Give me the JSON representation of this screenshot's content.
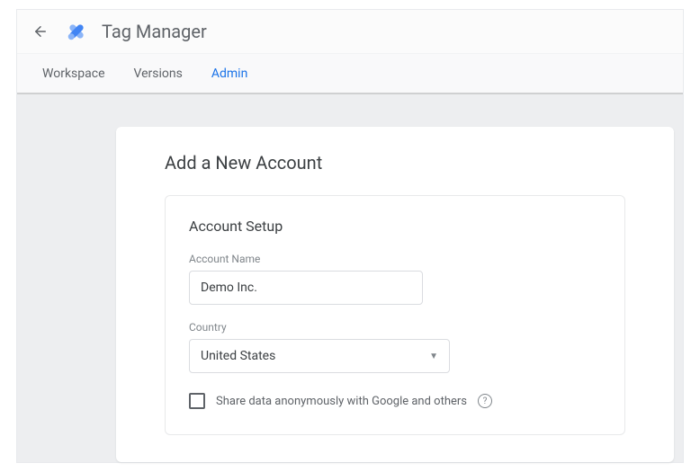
{
  "header": {
    "app_title": "Tag Manager"
  },
  "tabs": {
    "workspace": "Workspace",
    "versions": "Versions",
    "admin": "Admin",
    "active": "admin"
  },
  "page": {
    "title": "Add a New Account",
    "section_title": "Account Setup"
  },
  "form": {
    "account_name": {
      "label": "Account Name",
      "value": "Demo Inc."
    },
    "country": {
      "label": "Country",
      "value": "United States"
    },
    "share_data": {
      "label": "Share data anonymously with Google and others",
      "checked": false
    }
  }
}
